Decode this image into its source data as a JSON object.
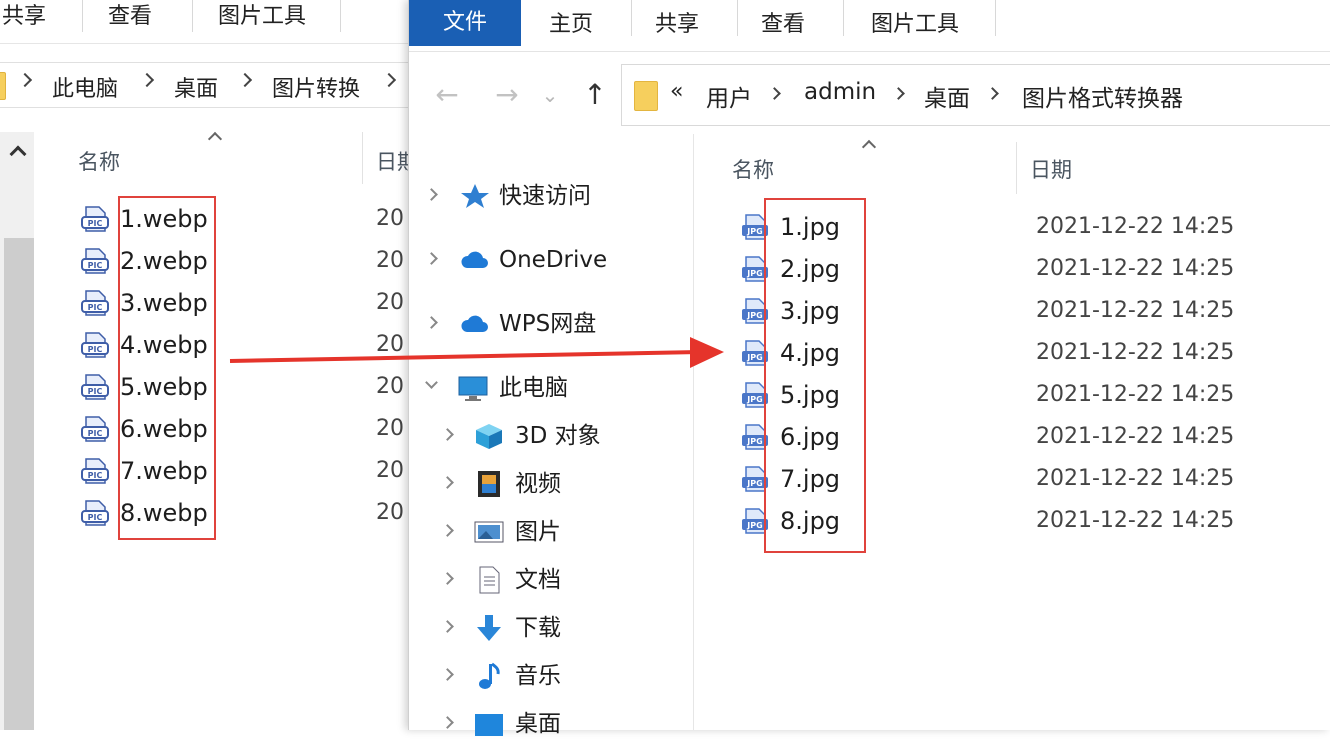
{
  "back_window": {
    "ribbon_tabs": [
      "共享",
      "查看",
      "图片工具"
    ],
    "breadcrumb": [
      "此电脑",
      "桌面",
      "图片转换"
    ],
    "columns": {
      "name": "名称",
      "date": "日期"
    },
    "files": [
      {
        "name": "1.webp",
        "date": "20"
      },
      {
        "name": "2.webp",
        "date": "20"
      },
      {
        "name": "3.webp",
        "date": "20"
      },
      {
        "name": "4.webp",
        "date": "20"
      },
      {
        "name": "5.webp",
        "date": "20"
      },
      {
        "name": "6.webp",
        "date": "20"
      },
      {
        "name": "7.webp",
        "date": "20"
      },
      {
        "name": "8.webp",
        "date": "20"
      }
    ],
    "file_icon_text": "PIC"
  },
  "front_window": {
    "file_tab": "文件",
    "ribbon_tabs": [
      "主页",
      "共享",
      "查看",
      "图片工具"
    ],
    "nav": {
      "back": "←",
      "forward": "→",
      "recent": "⌄",
      "up": "↑"
    },
    "address": {
      "overflow": "«",
      "crumbs": [
        "用户",
        "admin",
        "桌面",
        "图片格式转换器"
      ]
    },
    "sidebar": [
      {
        "label": "快速访问",
        "icon": "star-icon"
      },
      {
        "label": "OneDrive",
        "icon": "cloud-icon"
      },
      {
        "label": "WPS网盘",
        "icon": "cloud-icon"
      },
      {
        "label": "此电脑",
        "icon": "computer-icon"
      },
      {
        "label": "3D 对象",
        "icon": "cube-icon"
      },
      {
        "label": "视频",
        "icon": "video-icon"
      },
      {
        "label": "图片",
        "icon": "picture-icon"
      },
      {
        "label": "文档",
        "icon": "document-icon"
      },
      {
        "label": "下载",
        "icon": "download-icon"
      },
      {
        "label": "音乐",
        "icon": "music-icon"
      },
      {
        "label": "桌面",
        "icon": "desktop-icon"
      }
    ],
    "columns": {
      "name": "名称",
      "date": "日期"
    },
    "files": [
      {
        "name": "1.jpg",
        "date": "2021-12-22 14:25"
      },
      {
        "name": "2.jpg",
        "date": "2021-12-22 14:25"
      },
      {
        "name": "3.jpg",
        "date": "2021-12-22 14:25"
      },
      {
        "name": "4.jpg",
        "date": "2021-12-22 14:25"
      },
      {
        "name": "5.jpg",
        "date": "2021-12-22 14:25"
      },
      {
        "name": "6.jpg",
        "date": "2021-12-22 14:25"
      },
      {
        "name": "7.jpg",
        "date": "2021-12-22 14:25"
      },
      {
        "name": "8.jpg",
        "date": "2021-12-22 14:25"
      }
    ],
    "file_icon_text": "JPG"
  },
  "colors": {
    "accent": "#1a5fb4",
    "annotation": "#e0433c",
    "folder": "#f6cf5d"
  }
}
